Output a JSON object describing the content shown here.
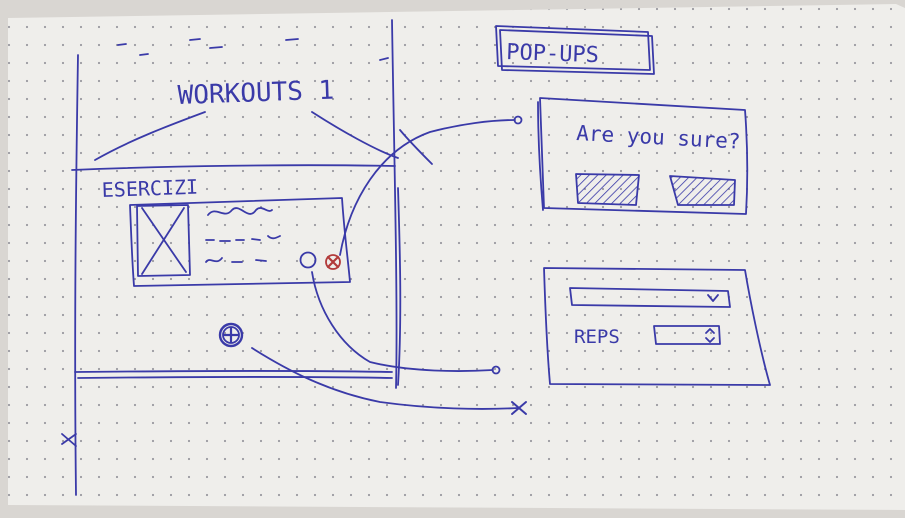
{
  "colors": {
    "paper": "#efeeeb",
    "ink": "#3a3aa8",
    "dot": "#9a9aa0",
    "accent_red": "#b23a3a"
  },
  "main_sketch": {
    "title": "WORKOUTS 1",
    "section_label": "ESERCIZI",
    "card": {
      "image_placeholder_icon": "crossed-box-icon",
      "settings_icon": "circle-icon",
      "delete_icon": "red-x-circle-icon"
    },
    "add_button_icon": "plus-circle-icon"
  },
  "popups": {
    "label": "POP-UPS",
    "confirm": {
      "question": "Are you sure?"
    },
    "edit": {
      "reps_label": "REPS"
    }
  }
}
